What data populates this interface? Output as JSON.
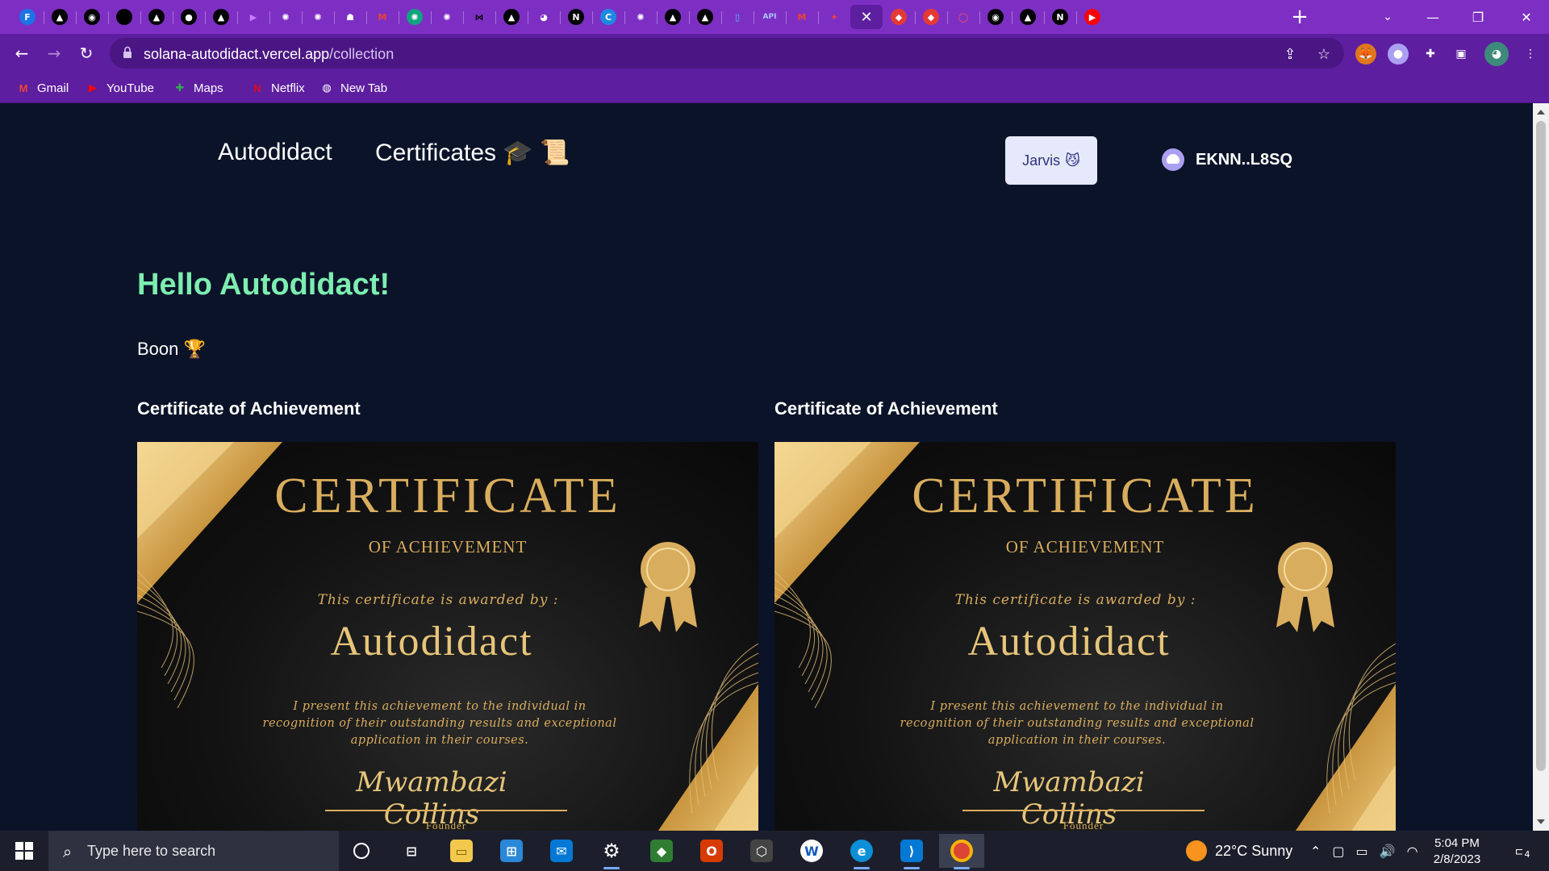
{
  "browser": {
    "tabs": [
      {
        "icon": "F",
        "color": "#1a73e8",
        "text_color": "#ffffff"
      },
      {
        "icon": "▲",
        "color": "#000000",
        "text_color": "#ffffff"
      },
      {
        "icon": "◉",
        "color": "#000000",
        "text_color": "#ffffff"
      },
      {
        "icon": "",
        "color": "#000000",
        "text_color": "#ffffff"
      },
      {
        "icon": "▲",
        "color": "#000000",
        "text_color": "#ffffff"
      },
      {
        "icon": "●",
        "color": "#000000",
        "text_color": "#ffffff"
      },
      {
        "icon": "▲",
        "color": "#000000",
        "text_color": "#ffffff"
      },
      {
        "icon": "▶",
        "color": "transparent",
        "text_color": "#c77dff"
      },
      {
        "icon": "✺",
        "color": "transparent",
        "text_color": "#ffffff"
      },
      {
        "icon": "✺",
        "color": "transparent",
        "text_color": "#ffffff"
      },
      {
        "icon": "☗",
        "color": "transparent",
        "text_color": "#ffffff"
      },
      {
        "icon": "M",
        "color": "transparent",
        "text_color": "#ea4335"
      },
      {
        "icon": "✺",
        "color": "#10a37f",
        "text_color": "#ffffff"
      },
      {
        "icon": "✺",
        "color": "transparent",
        "text_color": "#ffffff"
      },
      {
        "icon": "⋈",
        "color": "transparent",
        "text_color": "#000000"
      },
      {
        "icon": "▲",
        "color": "#000000",
        "text_color": "#ffffff"
      },
      {
        "icon": "◕",
        "color": "transparent",
        "text_color": "#ffffff"
      },
      {
        "icon": "N",
        "color": "#000000",
        "text_color": "#ffffff"
      },
      {
        "icon": "C",
        "color": "#1e88e5",
        "text_color": "#ffffff"
      },
      {
        "icon": "✺",
        "color": "transparent",
        "text_color": "#ffffff"
      },
      {
        "icon": "▲",
        "color": "#000000",
        "text_color": "#ffffff"
      },
      {
        "icon": "▲",
        "color": "#000000",
        "text_color": "#ffffff"
      },
      {
        "icon": "▯",
        "color": "transparent",
        "text_color": "#4fc3f7"
      },
      {
        "icon": "API",
        "color": "transparent",
        "text_color": "#a6c8ff"
      },
      {
        "icon": "M",
        "color": "transparent",
        "text_color": "#ea4335"
      },
      {
        "icon": "✦",
        "color": "transparent",
        "text_color": "#f44336"
      },
      {
        "icon": "✕",
        "color": "transparent",
        "text_color": "#ffffff",
        "active": true
      },
      {
        "icon": "◆",
        "color": "#e53935",
        "text_color": "#ffffff"
      },
      {
        "icon": "◆",
        "color": "#e53935",
        "text_color": "#ffffff"
      },
      {
        "icon": "◯",
        "color": "transparent",
        "text_color": "#ff5252"
      },
      {
        "icon": "◉",
        "color": "#000000",
        "text_color": "#ffffff"
      },
      {
        "icon": "▲",
        "color": "#000000",
        "text_color": "#ffffff"
      },
      {
        "icon": "N",
        "color": "#000000",
        "text_color": "#ffffff"
      },
      {
        "icon": "▶",
        "color": "#ff0000",
        "text_color": "#ffffff"
      }
    ],
    "url_host": "solana-autodidact.vercel.app",
    "url_path": "/collection",
    "bookmarks": [
      {
        "label": "Gmail",
        "icon": "M",
        "icon_color": "#ea4335"
      },
      {
        "label": "YouTube",
        "icon": "▶",
        "icon_color": "#ff0000"
      },
      {
        "label": "Maps",
        "icon": "✚",
        "icon_color": "#34a853"
      },
      {
        "label": "Netflix",
        "icon": "N",
        "icon_color": "#e50914"
      },
      {
        "label": "New Tab",
        "icon": "◍",
        "icon_color": "#ffffff"
      }
    ]
  },
  "site": {
    "brand": "Autodidact",
    "nav_link": "Certificates 🎓 📜",
    "jarvis_label": "Jarvis",
    "jarvis_emoji": "😼",
    "wallet_address": "EKNN..L8SQ"
  },
  "main": {
    "greeting": "Hello Autodidact!",
    "subtitle": "Boon 🏆",
    "certificates": [
      {
        "heading": "Certificate of Achievement",
        "title": "CERTIFICATE",
        "subtitle": "OF ACHIEVEMENT",
        "awarded_by": "This certificate is awarded by :",
        "name": "Autodidact",
        "body": "I present this achievement to the individual in recognition of their outstanding results and exceptional application in their courses.",
        "signature": "Mwambazi Collins",
        "role": "Founder"
      },
      {
        "heading": "Certificate of Achievement",
        "title": "CERTIFICATE",
        "subtitle": "OF ACHIEVEMENT",
        "awarded_by": "This certificate is awarded by :",
        "name": "Autodidact",
        "body": "I present this achievement to the individual in recognition of their outstanding results and exceptional application in their courses.",
        "signature": "Mwambazi Collins",
        "role": "Founder"
      }
    ]
  },
  "taskbar": {
    "search_placeholder": "Type here to search",
    "weather": "22°C  Sunny",
    "time": "5:04 PM",
    "date": "2/8/2023",
    "notification_count": "4"
  },
  "colors": {
    "chrome_purple": "#7e2fc3",
    "toolbar_purple": "#5d1ea0",
    "page_bg": "#0b1329",
    "greeting_green": "#7dedb0",
    "gold": "#d9ad5e"
  }
}
